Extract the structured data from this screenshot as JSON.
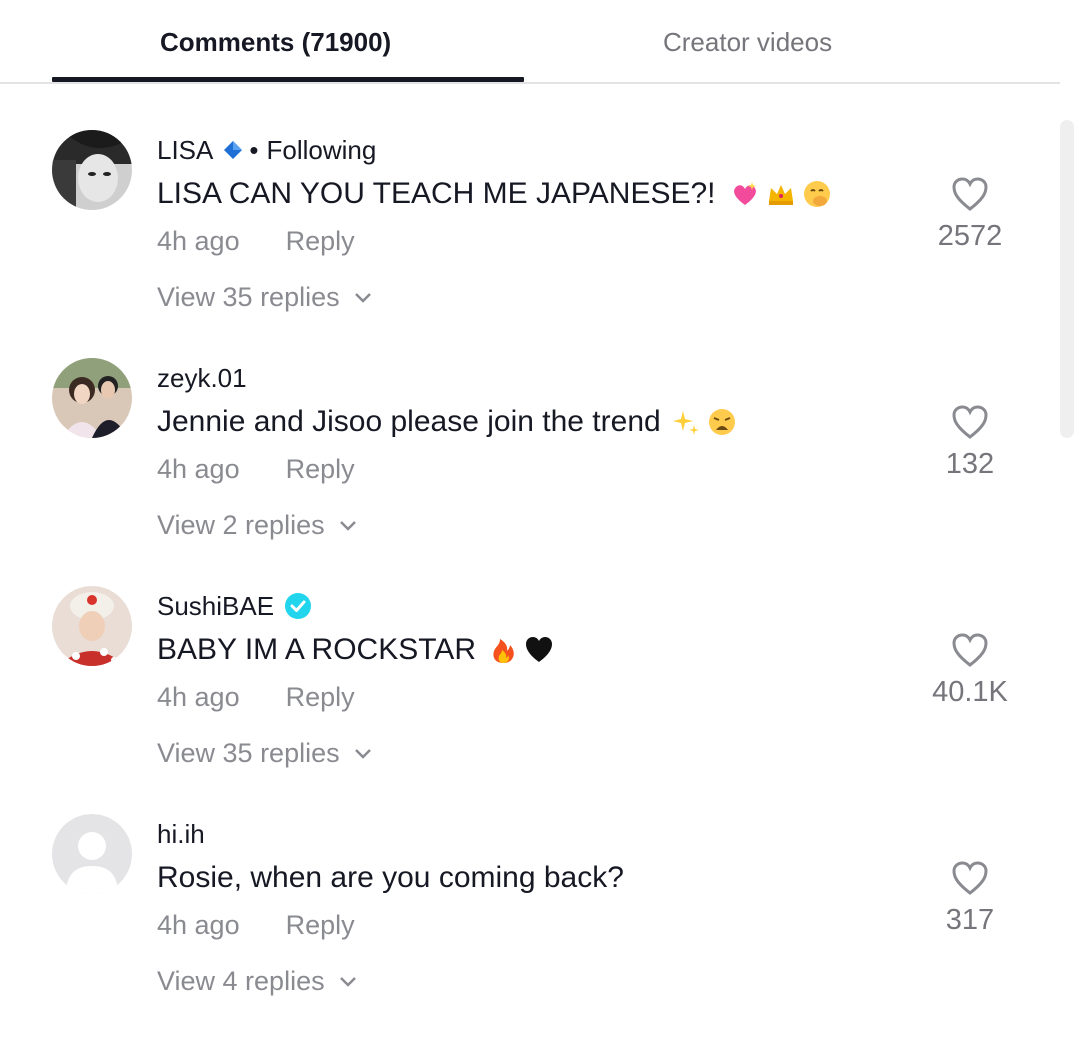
{
  "tabs": {
    "comments": "Comments (71900)",
    "creator_videos": "Creator videos"
  },
  "comments": [
    {
      "username": "LISA",
      "following": "Following",
      "text": "LISA CAN YOU TEACH ME JAPANESE?!",
      "emojis": [
        "sparkling-heart",
        "crown",
        "hand-over-mouth"
      ],
      "time": "4h ago",
      "reply": "Reply",
      "view_replies": "View 35 replies",
      "likes": "2572",
      "badge": "blue-diamond"
    },
    {
      "username": "zeyk.01",
      "text": "Jennie and Jisoo please join the trend",
      "emojis": [
        "sparkles",
        "weary-face"
      ],
      "time": "4h ago",
      "reply": "Reply",
      "view_replies": "View 2 replies",
      "likes": "132"
    },
    {
      "username": "SushiBAE",
      "text": "BABY IM A ROCKSTAR",
      "emojis": [
        "fire",
        "black-heart"
      ],
      "time": "4h ago",
      "reply": "Reply",
      "view_replies": "View 35 replies",
      "likes": "40.1K",
      "badge": "verified"
    },
    {
      "username": "hi.ih",
      "text": "Rosie, when are you coming back?",
      "emojis": [],
      "time": "4h ago",
      "reply": "Reply",
      "view_replies": "View 4 replies",
      "likes": "317"
    }
  ],
  "colors": {
    "primary_text": "#161823",
    "secondary_text": "#8a8b91",
    "verified": "#20d5ec",
    "diamond": "#1f6fd6"
  }
}
